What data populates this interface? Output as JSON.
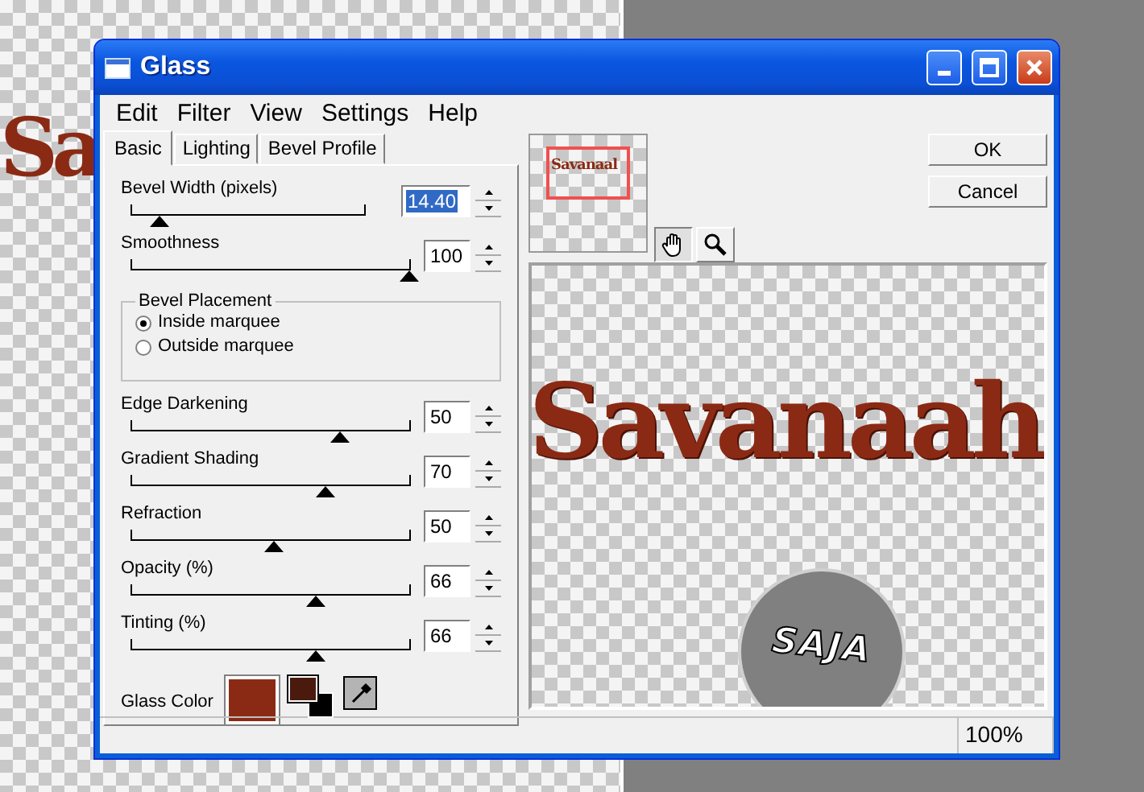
{
  "desktop": {
    "canvas_text": "Sa"
  },
  "window": {
    "title": "Glass"
  },
  "menu": [
    "Edit",
    "Filter",
    "View",
    "Settings",
    "Help"
  ],
  "tabs": [
    {
      "label": "Basic",
      "selected": true
    },
    {
      "label": "Lighting",
      "selected": false
    },
    {
      "label": "Bevel Profile",
      "selected": false
    }
  ],
  "controls": [
    {
      "kind": "slider",
      "label": "Bevel Width (pixels)",
      "value": "14.40",
      "level": 0.12,
      "value_selected": true,
      "wide": true
    },
    {
      "kind": "slider",
      "label": "Smoothness",
      "value": "100",
      "level": 1.0,
      "value_selected": false,
      "wide": false
    },
    {
      "kind": "group",
      "title": "Bevel Placement",
      "options": [
        {
          "label": "Inside marquee",
          "selected": true
        },
        {
          "label": "Outside marquee",
          "selected": false
        }
      ]
    },
    {
      "kind": "slider",
      "label": "Edge Darkening",
      "value": "50",
      "level": 0.75,
      "value_selected": false,
      "wide": false
    },
    {
      "kind": "slider",
      "label": "Gradient Shading",
      "value": "70",
      "level": 0.7,
      "value_selected": false,
      "wide": false
    },
    {
      "kind": "slider",
      "label": "Refraction",
      "value": "50",
      "level": 0.51,
      "value_selected": false,
      "wide": false
    },
    {
      "kind": "slider",
      "label": "Opacity (%)",
      "value": "66",
      "level": 0.66,
      "value_selected": false,
      "wide": false
    },
    {
      "kind": "slider",
      "label": "Tinting (%)",
      "value": "66",
      "level": 0.66,
      "value_selected": false,
      "wide": false
    }
  ],
  "glass_color": {
    "label": "Glass Color"
  },
  "tool_buttons": [
    {
      "kind": "pan",
      "selected": true
    },
    {
      "kind": "zoom",
      "selected": false
    }
  ],
  "buttons": [
    "OK",
    "Cancel"
  ],
  "preview": {
    "thumbnail_text": "Savanaal",
    "main_text": "Savanaah",
    "badge_text": "SAJA"
  },
  "status_bar": {
    "zoom": "100%"
  }
}
